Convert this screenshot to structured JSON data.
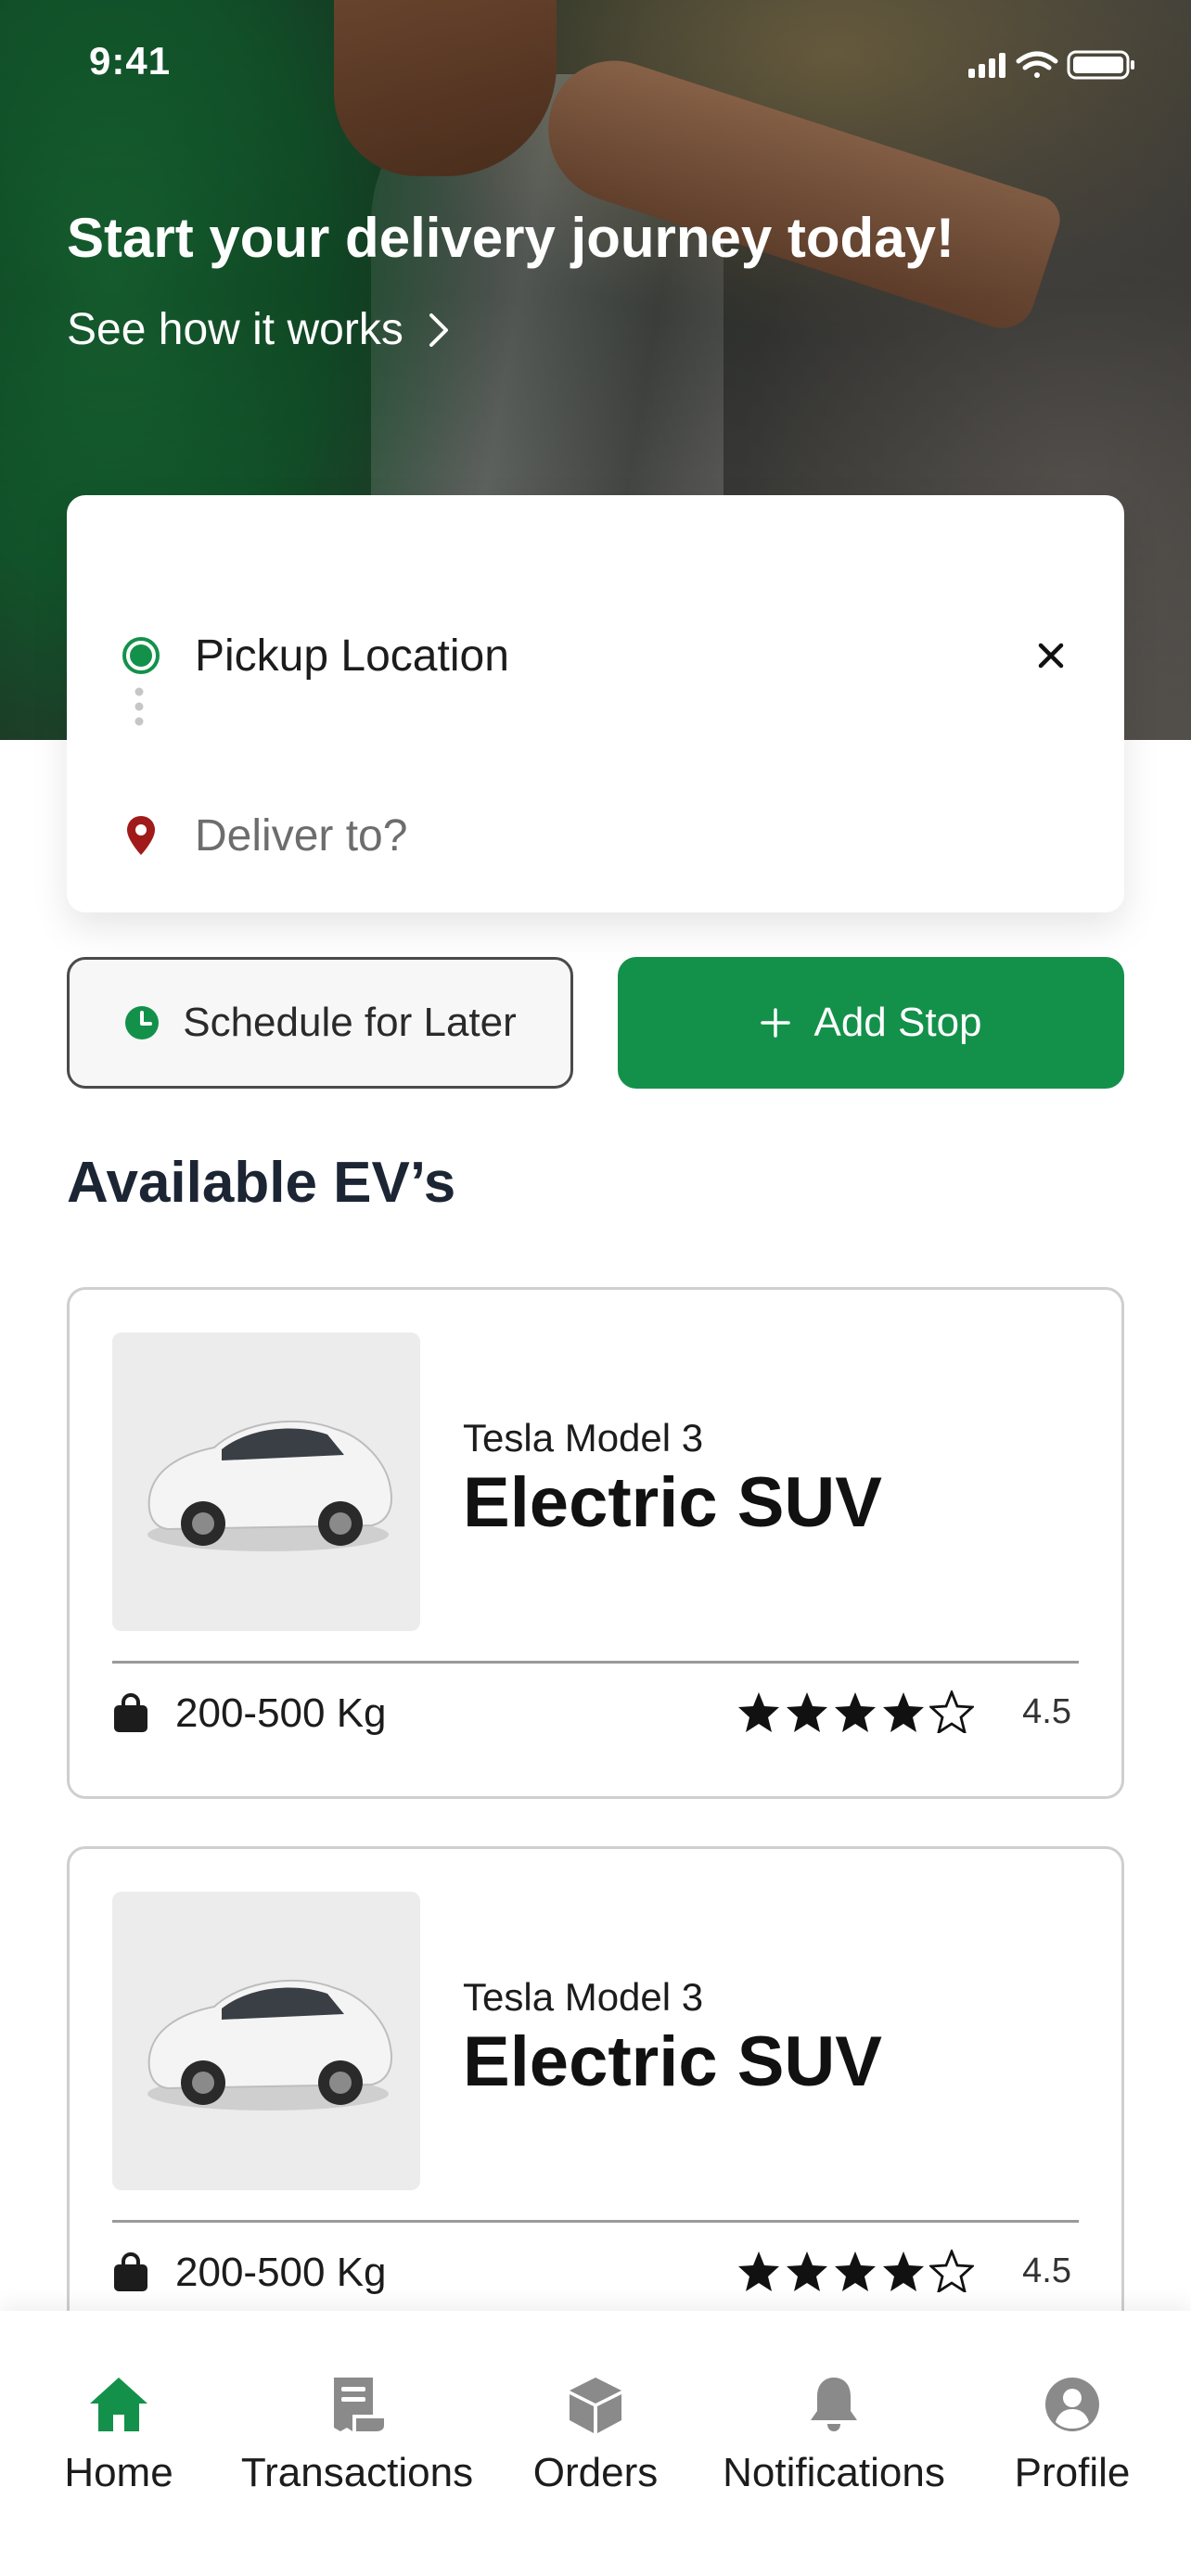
{
  "status_bar": {
    "time": "9:41"
  },
  "hero": {
    "title": "Start your delivery journey today!",
    "link_label": "See how it works"
  },
  "route": {
    "pickup_label": "Pickup Location",
    "deliver_placeholder": "Deliver to?"
  },
  "actions": {
    "schedule_label": "Schedule for Later",
    "add_stop_label": "Add Stop"
  },
  "available": {
    "title": "Available EV’s",
    "vehicles": [
      {
        "model": "Tesla Model 3",
        "type": "Electric SUV",
        "capacity": "200-500 Kg",
        "rating": "4.5",
        "stars_filled": 4
      },
      {
        "model": "Tesla Model 3",
        "type": "Electric SUV",
        "capacity": "200-500 Kg",
        "rating": "4.5",
        "stars_filled": 4
      }
    ]
  },
  "nav": {
    "items": [
      {
        "label": "Home",
        "icon": "home-icon",
        "active": true
      },
      {
        "label": "Transactions",
        "icon": "receipt-icon",
        "active": false
      },
      {
        "label": "Orders",
        "icon": "box-icon",
        "active": false
      },
      {
        "label": "Notifications",
        "icon": "bell-icon",
        "active": false
      },
      {
        "label": "Profile",
        "icon": "user-icon",
        "active": false
      }
    ]
  },
  "colors": {
    "brand_green": "#13914a",
    "pin_red": "#a11a1a",
    "inactive_icon": "#8a8a8a"
  }
}
